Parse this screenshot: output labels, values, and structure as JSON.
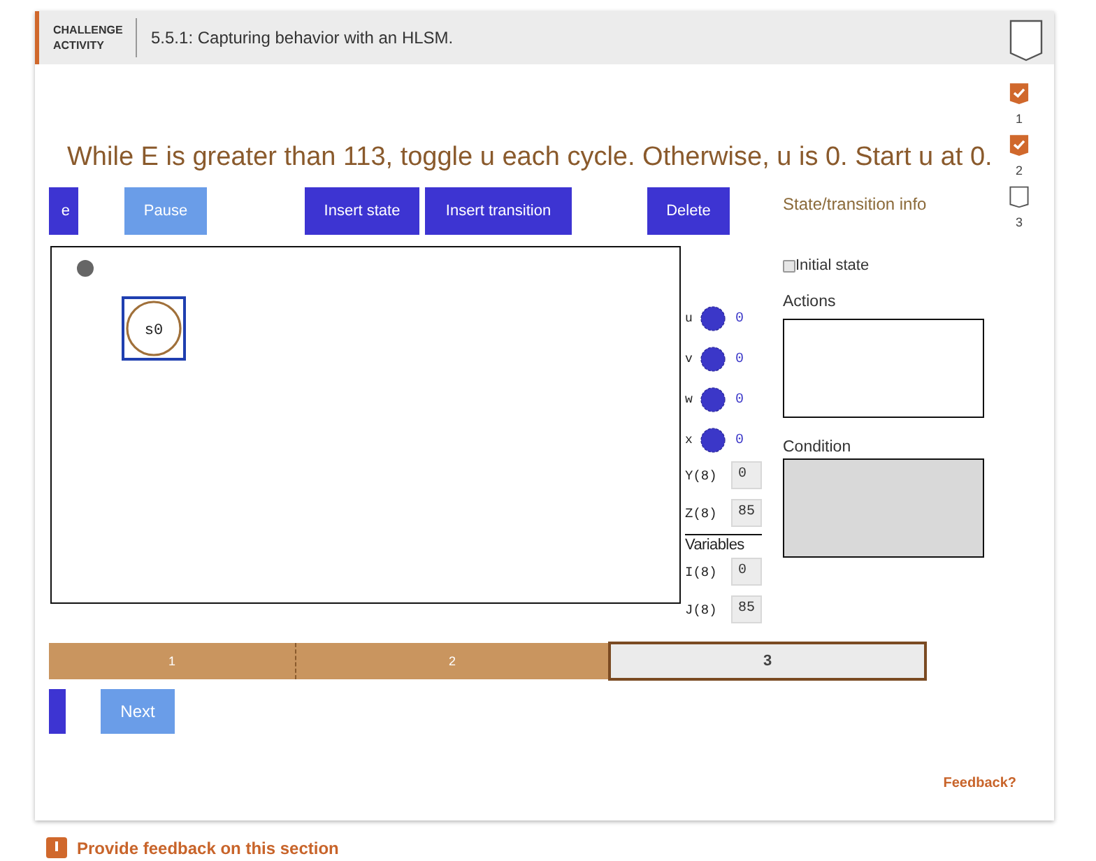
{
  "header": {
    "kind_label": "CHALLENGE ACTIVITY",
    "title": "5.5.1: Capturing behavior with an HLSM."
  },
  "level_markers": [
    {
      "number": "1",
      "completed": true
    },
    {
      "number": "2",
      "completed": true
    },
    {
      "number": "3",
      "completed": false
    }
  ],
  "instruction": "While E is greater than 113, toggle u each cycle. Otherwise, u is 0. Start u at 0.",
  "toolbar": {
    "buttons": [
      {
        "label": "e",
        "kind": "primary"
      },
      {
        "label": "Pause",
        "kind": "secondary"
      },
      {
        "label": "Insert state",
        "kind": "primary"
      },
      {
        "label": "Insert transition",
        "kind": "primary"
      },
      {
        "label": "Delete",
        "kind": "primary"
      }
    ],
    "info_title": "State/transition info"
  },
  "canvas": {
    "states": [
      {
        "name": "s0",
        "selected": true
      }
    ]
  },
  "outputs": [
    {
      "name": "u",
      "value": "0"
    },
    {
      "name": "v",
      "value": "0"
    },
    {
      "name": "w",
      "value": "0"
    },
    {
      "name": "x",
      "value": "0"
    }
  ],
  "registers": [
    {
      "name": "Y(8)",
      "value": "0"
    },
    {
      "name": "Z(8)",
      "value": "85"
    }
  ],
  "variables": {
    "title": "Variables",
    "items": [
      {
        "name": "I(8)",
        "value": "0"
      },
      {
        "name": "J(8)",
        "value": "85"
      }
    ]
  },
  "info_panel": {
    "initial_state": {
      "label": "Initial state",
      "checked": false
    },
    "actions": {
      "label": "Actions"
    },
    "condition": {
      "label": "Condition",
      "disabled": true
    }
  },
  "levels": [
    {
      "label": "1",
      "selected": false
    },
    {
      "label": "2",
      "selected": false
    },
    {
      "label": "3",
      "selected": true
    }
  ],
  "nav_buttons": [
    {
      "kind": "primary"
    },
    {
      "kind": "secondary",
      "label": "Next"
    }
  ],
  "feedback_link": "Feedback?",
  "section_feedback": "Provide feedback on this section"
}
